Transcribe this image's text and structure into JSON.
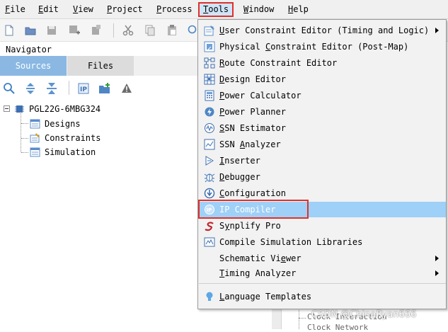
{
  "menubar": {
    "items": [
      {
        "label": "File",
        "mnemonic": "F",
        "rest": "ile"
      },
      {
        "label": "Edit",
        "mnemonic": "E",
        "rest": "dit"
      },
      {
        "label": "View",
        "mnemonic": "V",
        "rest": "iew"
      },
      {
        "label": "Project",
        "mnemonic": "P",
        "rest": "roject"
      },
      {
        "label": "Process",
        "mnemonic": "P",
        "rest": "rocess"
      },
      {
        "label": "Tools",
        "mnemonic": "T",
        "rest": "ools"
      },
      {
        "label": "Window",
        "mnemonic": "W",
        "rest": "indow"
      },
      {
        "label": "Help",
        "mnemonic": "H",
        "rest": "elp"
      }
    ]
  },
  "navigator": {
    "title": "Navigator",
    "tabs": [
      {
        "label": "Sources"
      },
      {
        "label": "Files"
      }
    ],
    "tree": {
      "root": "PGL22G-6MBG324",
      "children": [
        "Designs",
        "Constraints",
        "Simulation"
      ]
    }
  },
  "tools_menu": {
    "items": [
      {
        "label": "User Constraint Editor (Timing and Logic)",
        "icon": "constraint-editor-icon",
        "submenu": true
      },
      {
        "label": "Physical Constraint Editor (Post-Map)",
        "icon": "physical-constraint-icon"
      },
      {
        "label": "Route Constraint Editor",
        "icon": "route-constraint-icon"
      },
      {
        "label": "Design Editor",
        "icon": "design-editor-icon"
      },
      {
        "label": "Power Calculator",
        "icon": "calculator-icon"
      },
      {
        "label": "Power Planner",
        "icon": "power-planner-icon"
      },
      {
        "label": "SSN Estimator",
        "icon": "ssn-estimator-icon"
      },
      {
        "label": "SSN Analyzer",
        "icon": "ssn-analyzer-icon"
      },
      {
        "label": "Inserter",
        "icon": "inserter-icon"
      },
      {
        "label": "Debugger",
        "icon": "debugger-icon"
      },
      {
        "label": "Configuration",
        "icon": "configuration-icon"
      },
      {
        "label": "IP Compiler",
        "icon": "ip-compiler-icon"
      },
      {
        "label": "Synplify Pro",
        "icon": "synplify-icon"
      },
      {
        "label": "Compile Simulation Libraries",
        "icon": "simulation-libraries-icon"
      },
      {
        "label": "Schematic Viewer",
        "submenu": true
      },
      {
        "label": "Timing Analyzer",
        "submenu": true
      },
      {
        "label": "Language Templates",
        "icon": "lightbulb-icon"
      }
    ]
  },
  "background": {
    "line1": "Clock Interaction",
    "line2": "Clock Network"
  },
  "watermark": "CSDN @ChinaRyan666",
  "colors": {
    "highlight_box": "#e0302b",
    "selected_tab": "#8ab8e3",
    "hover_item": "#9fd0f7"
  }
}
